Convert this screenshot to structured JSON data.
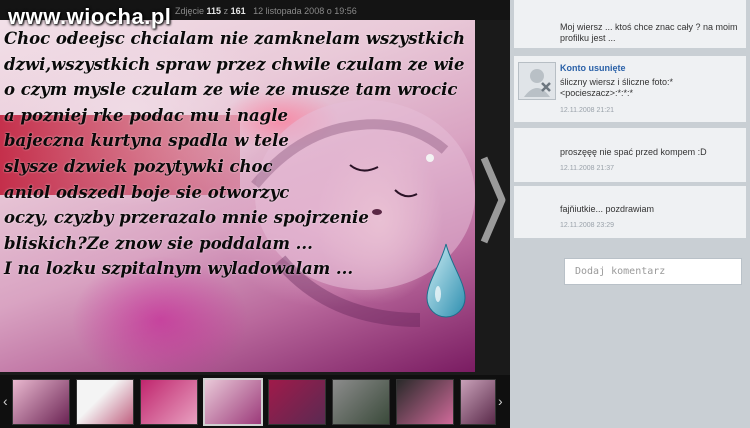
{
  "header": {
    "watermark": "www.wiocha.pl",
    "photo_label": "Zdjęcie",
    "photo_index": "115",
    "of_label": "z",
    "photo_total": "161",
    "photo_date": "12 listopada 2008 o 19:56"
  },
  "poem_lines": [
    "Choc odeejsc chcialam nie zamknelam wszystkich",
    "dzwi,wszystkich spraw przez chwile czulam ze wie",
    "o czym mysle czulam ze wie ze musze tam wrocic",
    "a pozniej rke podac mu i nagle",
    "bajeczna kurtyna spadla w tele",
    "slysze dzwiek pozytywki choc",
    "aniol odszedl boje sie otworzyc",
    "oczy, czyzby przerazalo mnie spojrzenie",
    "bliskich?Ze znow sie poddalam ...",
    "I na lozku szpitalnym wyladowalam ..."
  ],
  "comments": [
    {
      "text": "Moj wiersz ... ktoś chce znac cały ? na moim profilku jest ..."
    },
    {
      "author": "Konto usunięte",
      "text": "śliczny wiersz i śliczne foto:* <pocieszacz>:*:*:*",
      "date": "12.11.2008 21:21"
    },
    {
      "text": "proszęęę nie spać przed kompem :D",
      "date": "12.11.2008 21:37"
    },
    {
      "text": "fajňiutkie... pozdrawiam",
      "date": "12.11.2008 23:29"
    }
  ],
  "add_comment": {
    "placeholder": "Dodaj komentarz"
  },
  "icons": {
    "next": "chevron-right-icon",
    "strip_next": "strip-next-icon",
    "avatar": "deleted-user-icon"
  }
}
